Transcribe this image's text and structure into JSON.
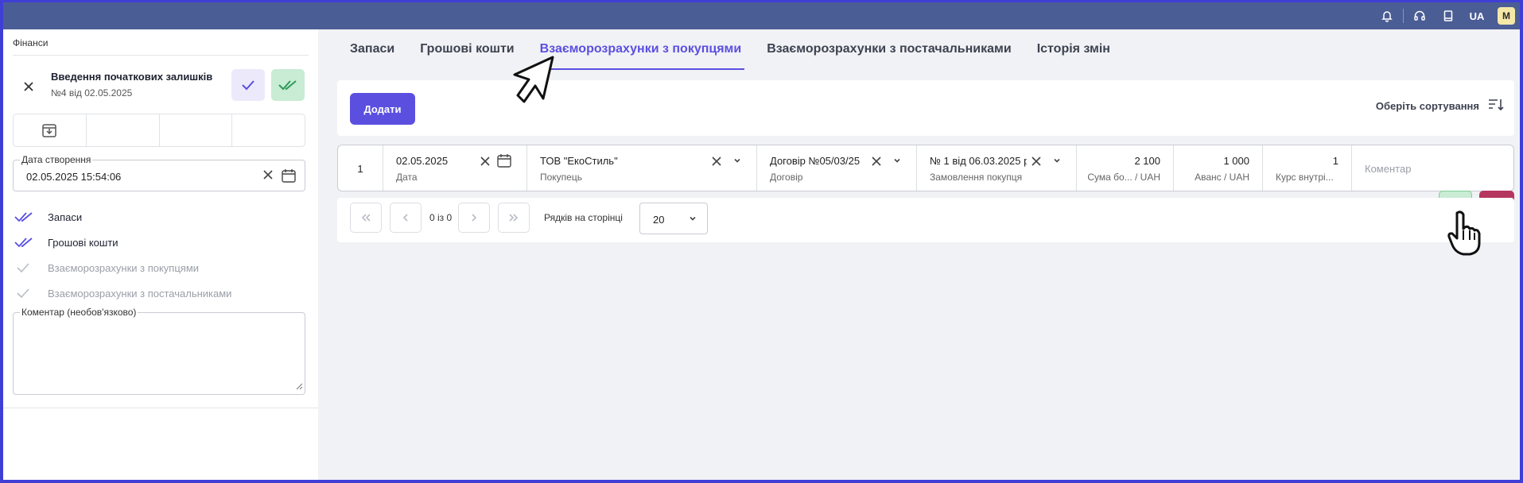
{
  "topbar": {
    "icons": [
      "bell-icon",
      "headset-icon",
      "book-icon"
    ],
    "language": "UA",
    "avatar_letter": "M"
  },
  "sidebar": {
    "section_title": "Фінанси",
    "document": {
      "title": "Введення початкових залишків",
      "subtitle": "№4 від 02.05.2025"
    },
    "creation_date": {
      "label": "Дата створення",
      "value": "02.05.2025 15:54:06"
    },
    "statuses": [
      {
        "label": "Запаси",
        "state": "done"
      },
      {
        "label": "Грошові кошти",
        "state": "done"
      },
      {
        "label": "Взаєморозрахунки з покупцями",
        "state": "pending"
      },
      {
        "label": "Взаєморозрахунки з постачальниками",
        "state": "pending"
      }
    ],
    "comment": {
      "label": "Коментар (необов'язково)",
      "value": ""
    }
  },
  "tabs": [
    {
      "label": "Запаси",
      "active": false
    },
    {
      "label": "Грошові кошти",
      "active": false
    },
    {
      "label": "Взаєморозрахунки з покупцями",
      "active": true
    },
    {
      "label": "Взаєморозрахунки з постачальниками",
      "active": false
    },
    {
      "label": "Історія змін",
      "active": false
    }
  ],
  "toolbar": {
    "add_label": "Додати",
    "sort_label": "Оберіть сортування"
  },
  "row": {
    "index": "1",
    "date": {
      "value": "02.05.2025",
      "label": "Дата"
    },
    "buyer": {
      "value": "ТОВ \"ЕкоСтиль\"",
      "label": "Покупець"
    },
    "contract": {
      "value": "Договір №05/03/25",
      "label": "Договір"
    },
    "order": {
      "value": "№ 1 від 06.03.2025 р",
      "label": "Замовлення покупця"
    },
    "amount": {
      "value": "2 100",
      "label": "Сума бо... / UAH"
    },
    "advance": {
      "value": "1 000",
      "label": "Аванс / UAH"
    },
    "rate": {
      "value": "1",
      "label": "Курс внутрі..."
    },
    "comment_placeholder": "Коментар"
  },
  "pagination": {
    "info": "0 із 0",
    "rows_label": "Рядків на сторінці",
    "rows_value": "20"
  },
  "colors": {
    "accent": "#5b4fe0",
    "topbar": "#4b5d95",
    "confirm": "#c9ecd4",
    "cancel": "#b5365f"
  }
}
